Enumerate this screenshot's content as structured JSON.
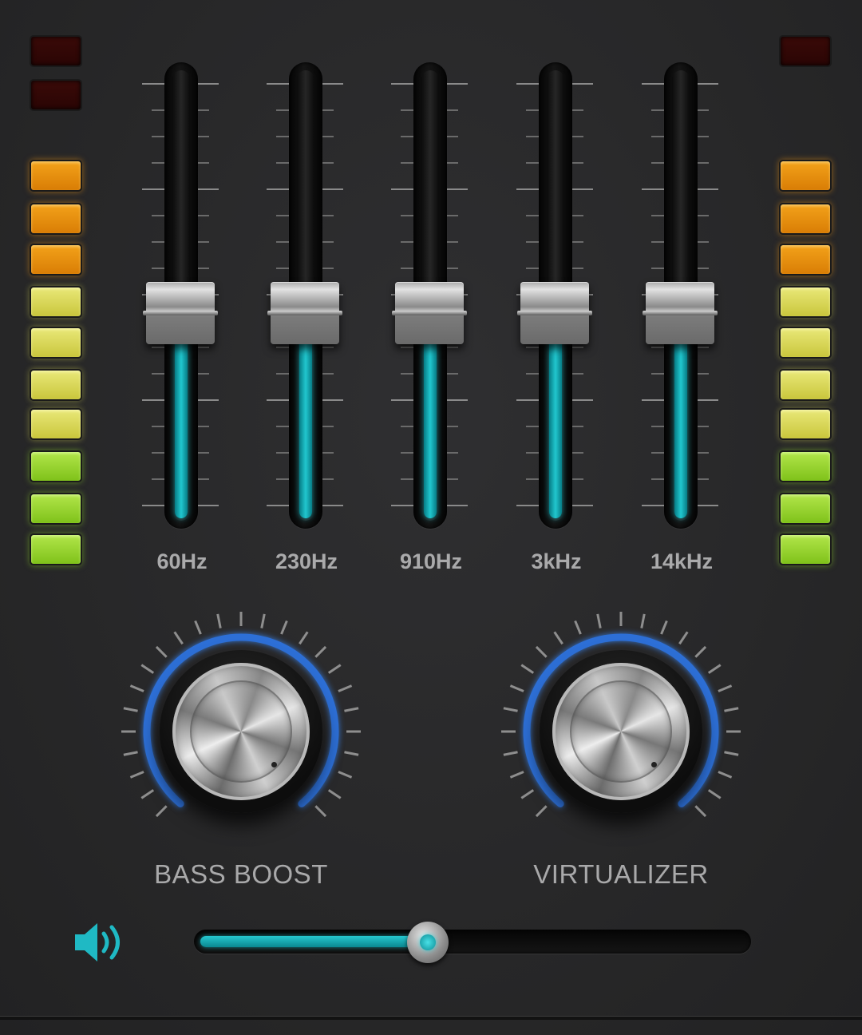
{
  "colors": {
    "accent": "#1fb9c4",
    "arc": "#2d6fd6",
    "label": "#aaaaab",
    "led_off": "#330806",
    "led_orange": "#ea9210",
    "led_yellow": "#dcd95a",
    "led_green": "#9bd633"
  },
  "meters": {
    "left": [
      "off",
      "off",
      "orange",
      "orange",
      "orange",
      "yellow",
      "yellow",
      "yellow",
      "yellow",
      "green",
      "green",
      "green"
    ],
    "right": [
      "off",
      "orange",
      "orange",
      "orange",
      "yellow",
      "yellow",
      "yellow",
      "yellow",
      "green",
      "green",
      "green"
    ]
  },
  "equalizer": {
    "bands": [
      {
        "label": "60Hz",
        "level": 0.43
      },
      {
        "label": "230Hz",
        "level": 0.43
      },
      {
        "label": "910Hz",
        "level": 0.43
      },
      {
        "label": "3kHz",
        "level": 0.43
      },
      {
        "label": "14kHz",
        "level": 0.43
      }
    ]
  },
  "effects": {
    "bass_boost": {
      "label": "BASS BOOST"
    },
    "virtualizer": {
      "label": "VIRTUALIZER"
    }
  },
  "volume": {
    "icon": "speaker-icon",
    "level": 0.4
  }
}
